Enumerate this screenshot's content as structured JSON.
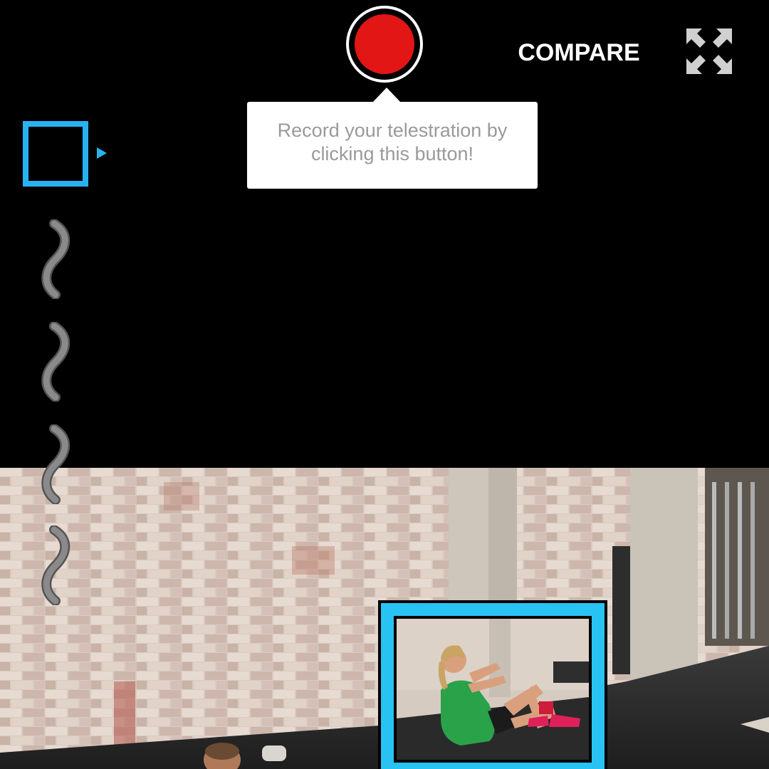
{
  "header": {
    "compare_label": "COMPARE",
    "record_button": {
      "icon": "record-icon",
      "color": "#e31616"
    },
    "fullscreen_icon": "expand-arrows-icon"
  },
  "tooltip": {
    "text": "Record your telestration by clicking this button!"
  },
  "tools": {
    "accent_color": "#29b2f2",
    "items": [
      {
        "icon": "rectangle-tool-icon",
        "selected": true
      },
      {
        "icon": "freehand-tool-icon",
        "selected": false
      },
      {
        "icon": "freehand-tool-icon",
        "selected": false
      },
      {
        "icon": "freehand-tool-icon",
        "selected": false
      },
      {
        "icon": "freehand-tool-icon",
        "selected": false
      }
    ]
  },
  "video": {
    "annotation_color": "#29c3f3"
  }
}
